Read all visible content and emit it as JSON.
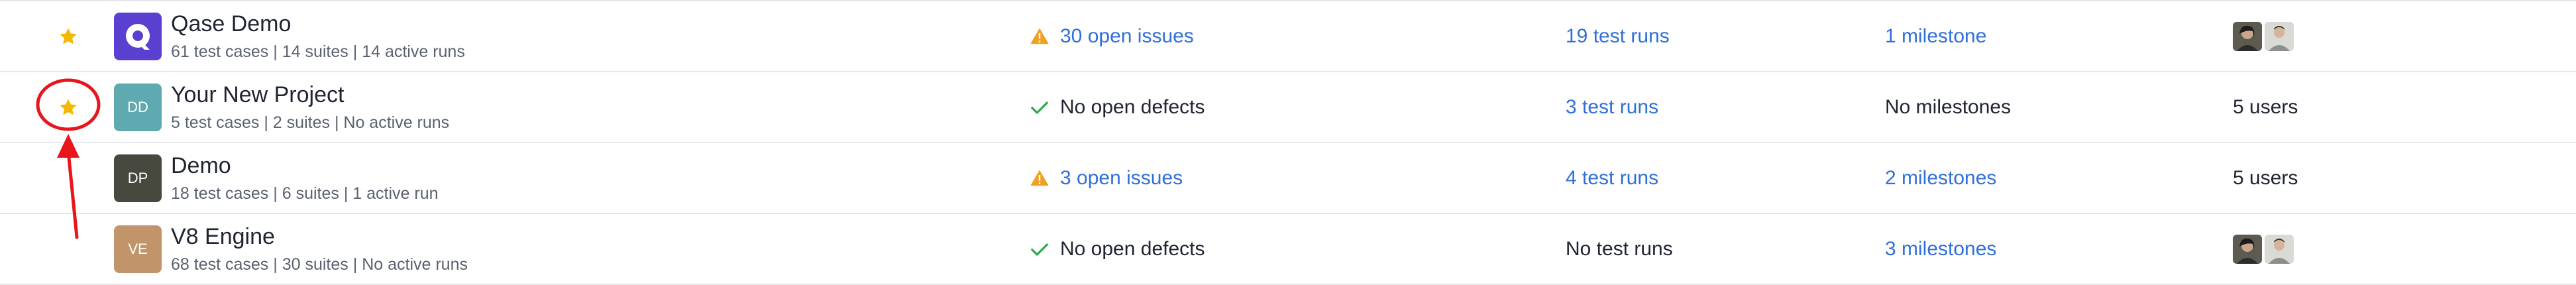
{
  "projects": [
    {
      "name": "Qase Demo",
      "avatar_text": "Q",
      "avatar_color": "#5b3fd0",
      "meta": {
        "test_cases": "61 test cases",
        "suites": "14 suites",
        "runs": "14 active runs"
      },
      "starred": true,
      "issues": {
        "icon": "warning-icon",
        "text": "30 open issues",
        "link": true
      },
      "test_runs": {
        "text": "19 test runs",
        "link": true
      },
      "milestones": {
        "text": "1 milestone",
        "link": true
      },
      "users": {
        "type": "avatars"
      }
    },
    {
      "name": "Your New Project",
      "avatar_text": "DD",
      "avatar_color": "#5eaab0",
      "meta": {
        "test_cases": "5 test cases",
        "suites": "2 suites",
        "runs": "No active runs"
      },
      "starred": true,
      "issues": {
        "icon": "check-icon",
        "text": "No open defects",
        "link": false
      },
      "test_runs": {
        "text": "3 test runs",
        "link": true
      },
      "milestones": {
        "text": "No milestones",
        "link": false
      },
      "users": {
        "type": "text",
        "text": "5 users"
      }
    },
    {
      "name": "Demo",
      "avatar_text": "DP",
      "avatar_color": "#47493e",
      "meta": {
        "test_cases": "18 test cases",
        "suites": "6 suites",
        "runs": "1 active run"
      },
      "starred": false,
      "issues": {
        "icon": "warning-icon",
        "text": "3 open issues",
        "link": true
      },
      "test_runs": {
        "text": "4 test runs",
        "link": true
      },
      "milestones": {
        "text": "2 milestones",
        "link": true
      },
      "users": {
        "type": "text",
        "text": "5 users"
      }
    },
    {
      "name": "V8 Engine",
      "avatar_text": "VE",
      "avatar_color": "#c2946a",
      "meta": {
        "test_cases": "68 test cases",
        "suites": "30 suites",
        "runs": "No active runs"
      },
      "starred": false,
      "issues": {
        "icon": "check-icon",
        "text": "No open defects",
        "link": false
      },
      "test_runs": {
        "text": "No test runs",
        "link": false
      },
      "milestones": {
        "text": "3 milestones",
        "link": true
      },
      "users": {
        "type": "avatars"
      }
    }
  ],
  "separator": "|",
  "colors": {
    "link": "#2f6fdb",
    "star": "#f5b800",
    "warning": "#f0a020",
    "check": "#2fa84f",
    "annotation": "#e8151d"
  }
}
